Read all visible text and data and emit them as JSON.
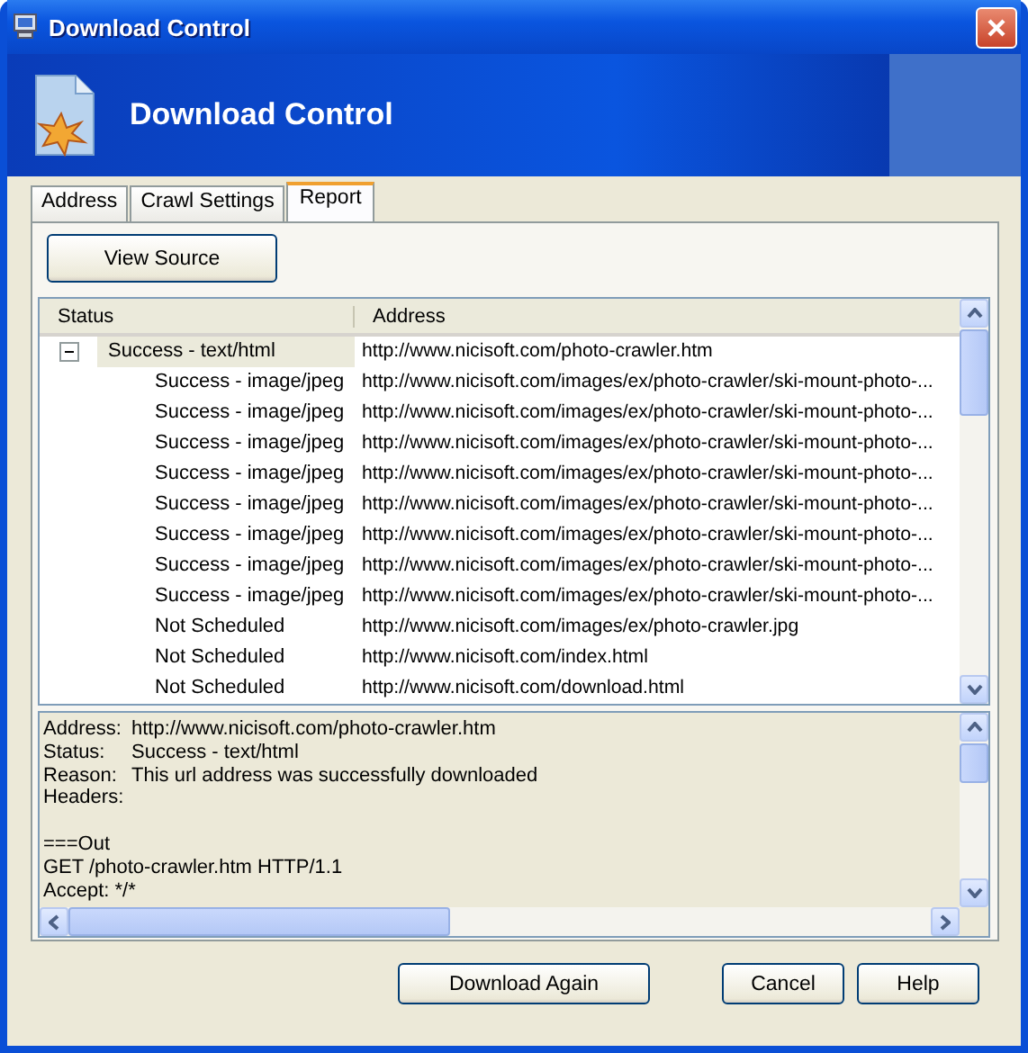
{
  "window": {
    "title": "Download Control"
  },
  "banner": {
    "title": "Download Control"
  },
  "tabs": [
    {
      "label": "Address",
      "selected": false
    },
    {
      "label": "Crawl Settings",
      "selected": false
    },
    {
      "label": "Report",
      "selected": true
    }
  ],
  "view_source_button": "View Source",
  "table": {
    "columns": [
      "Status",
      "Address"
    ],
    "rows": [
      {
        "status": "Success - text/html",
        "address": "http://www.nicisoft.com/photo-crawler.htm",
        "selected": true,
        "expanded": true,
        "children": [
          {
            "status": "Success - image/jpeg",
            "address": "http://www.nicisoft.com/images/ex/photo-crawler/ski-mount-photo-...",
            "selected": false
          },
          {
            "status": "Success - image/jpeg",
            "address": "http://www.nicisoft.com/images/ex/photo-crawler/ski-mount-photo-...",
            "selected": false
          },
          {
            "status": "Success - image/jpeg",
            "address": "http://www.nicisoft.com/images/ex/photo-crawler/ski-mount-photo-...",
            "selected": false
          },
          {
            "status": "Success - image/jpeg",
            "address": "http://www.nicisoft.com/images/ex/photo-crawler/ski-mount-photo-...",
            "selected": false
          },
          {
            "status": "Success - image/jpeg",
            "address": "http://www.nicisoft.com/images/ex/photo-crawler/ski-mount-photo-...",
            "selected": false
          },
          {
            "status": "Success - image/jpeg",
            "address": "http://www.nicisoft.com/images/ex/photo-crawler/ski-mount-photo-...",
            "selected": false
          },
          {
            "status": "Success - image/jpeg",
            "address": "http://www.nicisoft.com/images/ex/photo-crawler/ski-mount-photo-...",
            "selected": false
          },
          {
            "status": "Success - image/jpeg",
            "address": "http://www.nicisoft.com/images/ex/photo-crawler/ski-mount-photo-...",
            "selected": false
          },
          {
            "status": "Not Scheduled",
            "address": "http://www.nicisoft.com/images/ex/photo-crawler.jpg",
            "selected": false
          },
          {
            "status": "Not Scheduled",
            "address": "http://www.nicisoft.com/index.html",
            "selected": false
          },
          {
            "status": "Not Scheduled",
            "address": "http://www.nicisoft.com/download.html",
            "selected": false
          }
        ]
      }
    ]
  },
  "details": {
    "fields": [
      {
        "label": "Address:",
        "value": "http://www.nicisoft.com/photo-crawler.htm"
      },
      {
        "label": "Status:",
        "value": "Success - text/html"
      },
      {
        "label": "Reason:",
        "value": "This url address was successfully downloaded"
      },
      {
        "label": "Headers:"
      }
    ],
    "lines": [
      "===Out",
      "GET /photo-crawler.htm HTTP/1.1",
      "Accept: */*"
    ]
  },
  "buttons": [
    "Download Again",
    "Cancel",
    "Help"
  ]
}
